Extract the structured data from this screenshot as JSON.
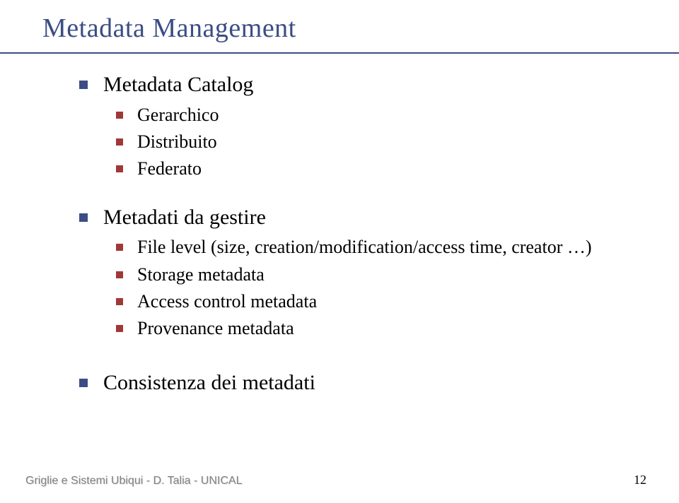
{
  "title": "Metadata Management",
  "bullets": {
    "item1": {
      "label": "Metadata Catalog",
      "children": {
        "a": "Gerarchico",
        "b": "Distribuito",
        "c": "Federato"
      }
    },
    "item2": {
      "label": "Metadati da gestire",
      "children": {
        "a": "File level (size, creation/modification/access time, creator …)",
        "b": "Storage metadata",
        "c": "Access control metadata",
        "d": "Provenance metadata"
      }
    },
    "item3": {
      "label": "Consistenza dei metadati"
    }
  },
  "footer": "Griglie e Sistemi Ubiqui - D. Talia - UNICAL",
  "page_number": "12"
}
